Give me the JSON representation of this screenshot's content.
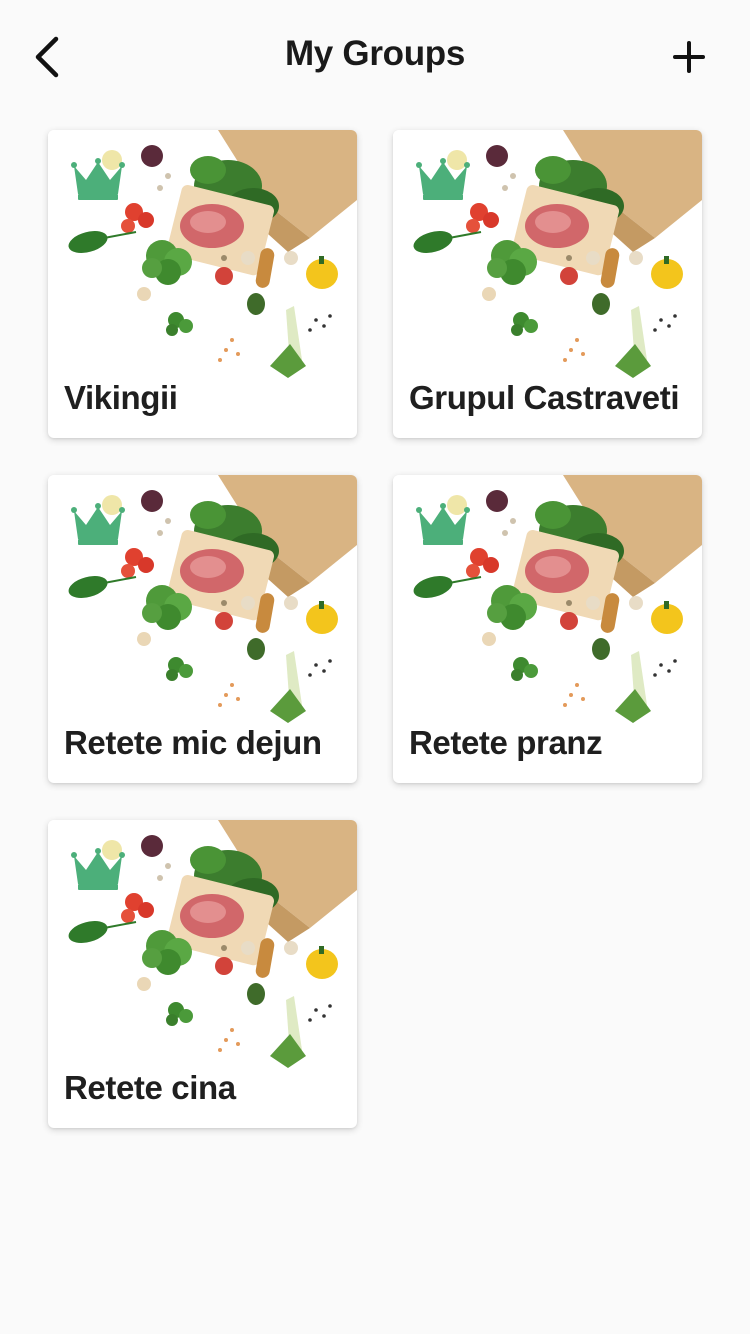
{
  "header": {
    "title": "My Groups",
    "back_icon": "chevron-left-icon",
    "add_icon": "plus-icon"
  },
  "groups": [
    {
      "name": "Vikingii",
      "owner_badge": "crown-icon"
    },
    {
      "name": "Grupul Castraveti",
      "owner_badge": "crown-icon"
    },
    {
      "name": "Retete mic dejun",
      "owner_badge": "crown-icon"
    },
    {
      "name": "Retete pranz",
      "owner_badge": "crown-icon"
    },
    {
      "name": "Retete cina",
      "owner_badge": "crown-icon"
    }
  ],
  "colors": {
    "background": "#fafafa",
    "crown": "#4caf7a",
    "text": "#1a1a1a"
  }
}
